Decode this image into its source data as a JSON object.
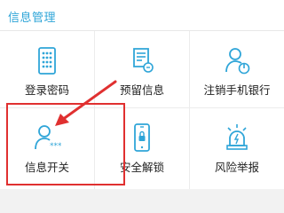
{
  "panel": {
    "title": "信息管理"
  },
  "grid": {
    "items": [
      {
        "label": "登录密码",
        "icon": "keypad-icon"
      },
      {
        "label": "预留信息",
        "icon": "message-note-icon"
      },
      {
        "label": "注销手机银行",
        "icon": "power-user-icon"
      },
      {
        "label": "信息开关",
        "icon": "user-stars-icon"
      },
      {
        "label": "安全解锁",
        "icon": "phone-lock-icon"
      },
      {
        "label": "风险举报",
        "icon": "alarm-light-icon"
      }
    ]
  },
  "colors": {
    "accent": "#2fa5d8",
    "highlight": "#e03030",
    "label": "#222222"
  }
}
